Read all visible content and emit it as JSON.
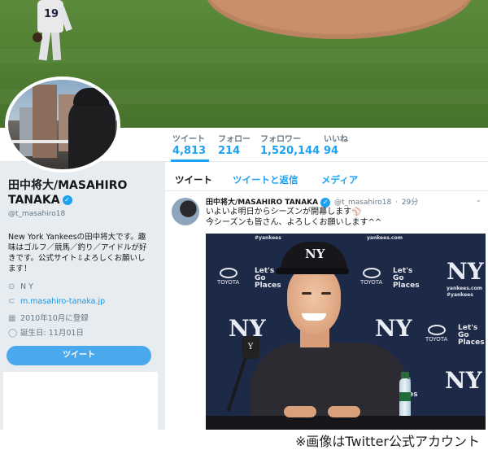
{
  "banner": {
    "jersey_number": "19"
  },
  "nav": {
    "stats": [
      {
        "label": "ツイート",
        "value": "4,813"
      },
      {
        "label": "フォロー",
        "value": "214"
      },
      {
        "label": "フォロワー",
        "value": "1,520,144"
      },
      {
        "label": "いいね",
        "value": "94"
      }
    ]
  },
  "profile": {
    "name_line1": "田中将大/MASAHIRO",
    "name_line2": "TANAKA",
    "handle": "@t_masahiro18",
    "bio": "New York Yankeesの田中将大です。趣味はゴルフ／競馬／釣り／アイドルが好きです。公式サイト⇩よろしくお願いします！",
    "location": "N Y",
    "website": "m.masahiro-tanaka.jp",
    "joined": "2010年10月に登録",
    "birthday": "誕生日: 11月01日",
    "tweet_button": "ツイート"
  },
  "timeline": {
    "tabs": [
      "ツイート",
      "ツイートと返信",
      "メディア"
    ],
    "tweet": {
      "name": "田中将大/MASAHIRO TANAKA",
      "handle": "@t_masahiro18",
      "time": "29分",
      "line1": "いよいよ明日からシーズンが開幕します⚾",
      "line2": "今シーズンも皆さん、よろしくお願いします^^"
    },
    "photo": {
      "toyota": "TOYOTA",
      "lets_go_places": "Let's Go Places",
      "yankees_tag": "#yankees",
      "yankees_site": "yankees.com",
      "cap_logo": "NY"
    }
  },
  "caption": "※画像はTwitter公式アカウント",
  "colors": {
    "accent": "#1da1f2",
    "button": "#4aa9ec",
    "grass": "#4f7d31"
  }
}
